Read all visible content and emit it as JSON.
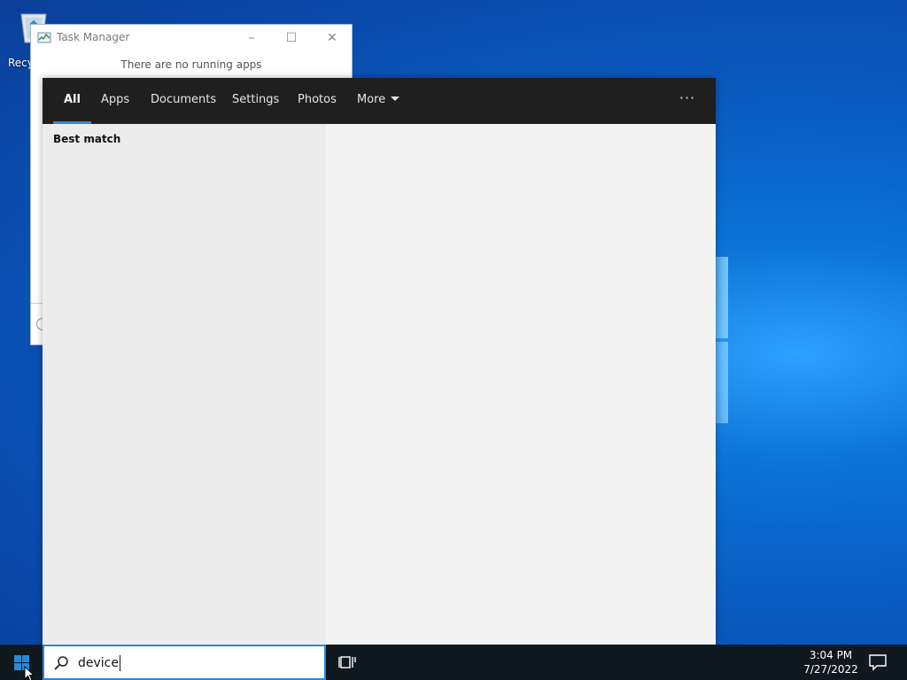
{
  "desktop": {
    "recycle_bin_label": "Recy"
  },
  "task_manager": {
    "title": "Task Manager",
    "empty_message": "There are no running apps",
    "minimize": "–",
    "maximize": "☐",
    "close": "✕"
  },
  "search": {
    "tabs": [
      {
        "label": "All",
        "active": true
      },
      {
        "label": "Apps"
      },
      {
        "label": "Documents"
      },
      {
        "label": "Settings"
      },
      {
        "label": "Photos"
      },
      {
        "label": "More"
      }
    ],
    "options_label": "···",
    "section_heading": "Best match",
    "query": "device"
  },
  "taskbar": {
    "time": "3:04 PM",
    "date": "7/27/2022"
  },
  "colors": {
    "accent": "#2b88d8",
    "header_bg": "#1f1f1f",
    "taskbar_bg": "#101820"
  }
}
